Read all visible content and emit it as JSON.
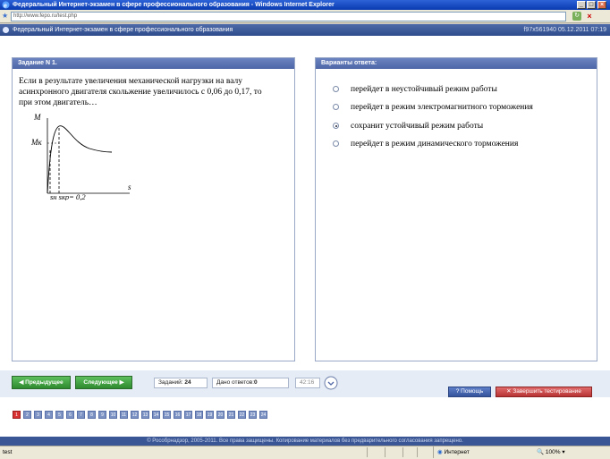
{
  "window": {
    "title": "Федеральный Интернет-экзамен в сфере профессионального образования - Windows Internet Explorer",
    "url": "http://www.fepo.ru/test.php"
  },
  "page_header": {
    "title": "Федеральный Интернет-экзамен в сфере профессионального образования",
    "info": "f97x561940 05.12.2011 07:19"
  },
  "question": {
    "header": "Задание N 1.",
    "text": "Если в результате увеличения механической нагрузки на валу асинхронного двигателя скольжение увеличилось с 0,06 до 0,17, то при этом двигатель…",
    "figure": {
      "y_axis": "M",
      "y_mark": "Mк",
      "x_axis": "s",
      "x_labels": "sн sкр= 0,2"
    }
  },
  "answers": {
    "header": "Варианты ответа:",
    "options": [
      {
        "label": "перейдет в неустойчивый режим работы",
        "selected": false
      },
      {
        "label": "перейдет в режим электромагнитного торможения",
        "selected": false
      },
      {
        "label": "сохранит устойчивый режим работы",
        "selected": true
      },
      {
        "label": "перейдет в режим динамического торможения",
        "selected": false
      }
    ]
  },
  "nav": {
    "prev_label": "Предыдущее",
    "next_label": "Следующее",
    "tasks_label": "Заданий:",
    "tasks_value": "24",
    "answered_label": "Дано ответов:",
    "answered_value": "0",
    "timer": "42:16",
    "help_label": "Помощь",
    "finish_label": "Завершить тестирование"
  },
  "pages": {
    "current": 1,
    "numbers": [
      "1",
      "2",
      "3",
      "4",
      "5",
      "6",
      "7",
      "8",
      "9",
      "10",
      "11",
      "12",
      "13",
      "14",
      "15",
      "16",
      "17",
      "18",
      "19",
      "20",
      "21",
      "22",
      "23",
      "24"
    ]
  },
  "footer": "© Рособрнадзор, 2005-2011. Все права защищены. Копирование материалов без предварительного согласования запрещено.",
  "status": {
    "left": "test",
    "zone": "Интернет",
    "zoom": "100%"
  },
  "colors": {
    "accent": "#4e66a6",
    "nav_green": "#2e8a2e",
    "finish_red": "#b83434",
    "current_page": "#d83232"
  }
}
